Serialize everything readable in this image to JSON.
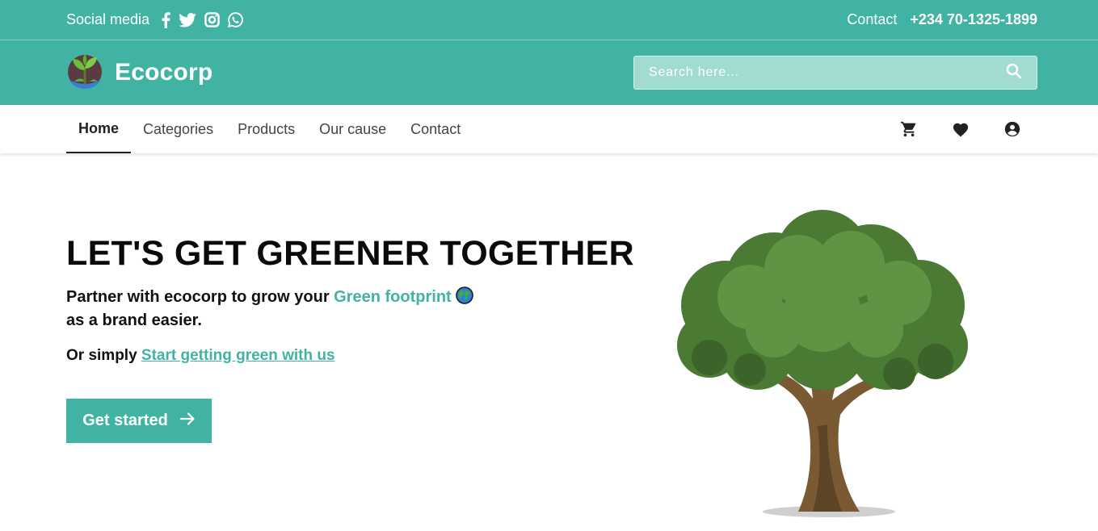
{
  "topbar": {
    "social_label": "Social media",
    "social_icons": [
      "facebook-icon",
      "twitter-icon",
      "instagram-icon",
      "whatsapp-icon"
    ],
    "contact_label": "Contact",
    "phone": "+234 70-1325-1899"
  },
  "brand": {
    "name": "Ecocorp",
    "logo_icon": "plant-globe-logo"
  },
  "search": {
    "placeholder": "Search here..."
  },
  "nav": {
    "items": [
      {
        "label": "Home",
        "active": true
      },
      {
        "label": "Categories"
      },
      {
        "label": "Products"
      },
      {
        "label": "Our cause"
      },
      {
        "label": "Contact"
      }
    ],
    "icons": [
      "cart-icon",
      "heart-icon",
      "account-icon"
    ]
  },
  "hero": {
    "title": "LET'S GET GREENER TOGETHER",
    "sub_prefix": "Partner with ecocorp to grow your ",
    "sub_accent": "Green footprint",
    "sub_suffix": "as a brand easier.",
    "or_text": "Or simply ",
    "or_link": "Start getting green with us",
    "cta_label": "Get started"
  },
  "colors": {
    "accent": "#41b3a3",
    "search_bg": "#a1dbd2"
  }
}
